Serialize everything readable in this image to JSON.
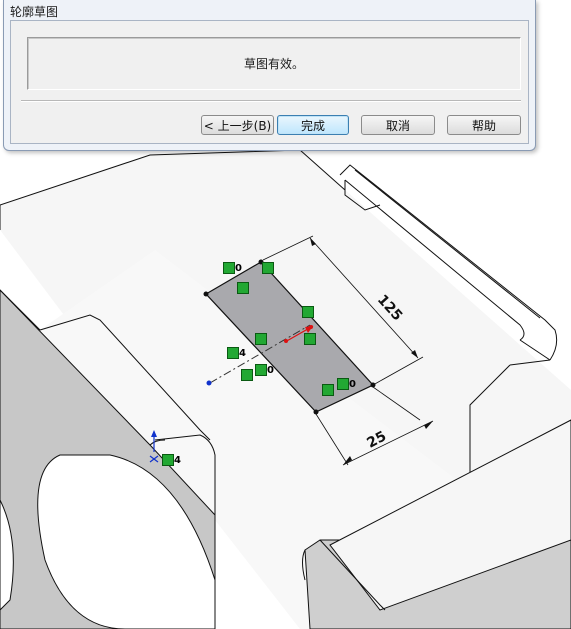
{
  "dialog": {
    "title": "轮廓草图",
    "message": "草图有效。",
    "buttons": {
      "back": "< 上一步(B)",
      "finish": "完成",
      "cancel": "取消",
      "help": "帮助"
    }
  },
  "viewport": {
    "dimensions": {
      "length": "125",
      "width": "25"
    },
    "relation_labels": {
      "fix_top": "0",
      "fix_right": "0",
      "fix_mid": "0",
      "coincident_left": "4",
      "coincident_origin": "4"
    },
    "colors": {
      "sketch_fill": "#a9a9ad",
      "relation_icon": "#22a833",
      "origin_blue": "#1133cc",
      "arrow_red": "#dd1111"
    }
  }
}
